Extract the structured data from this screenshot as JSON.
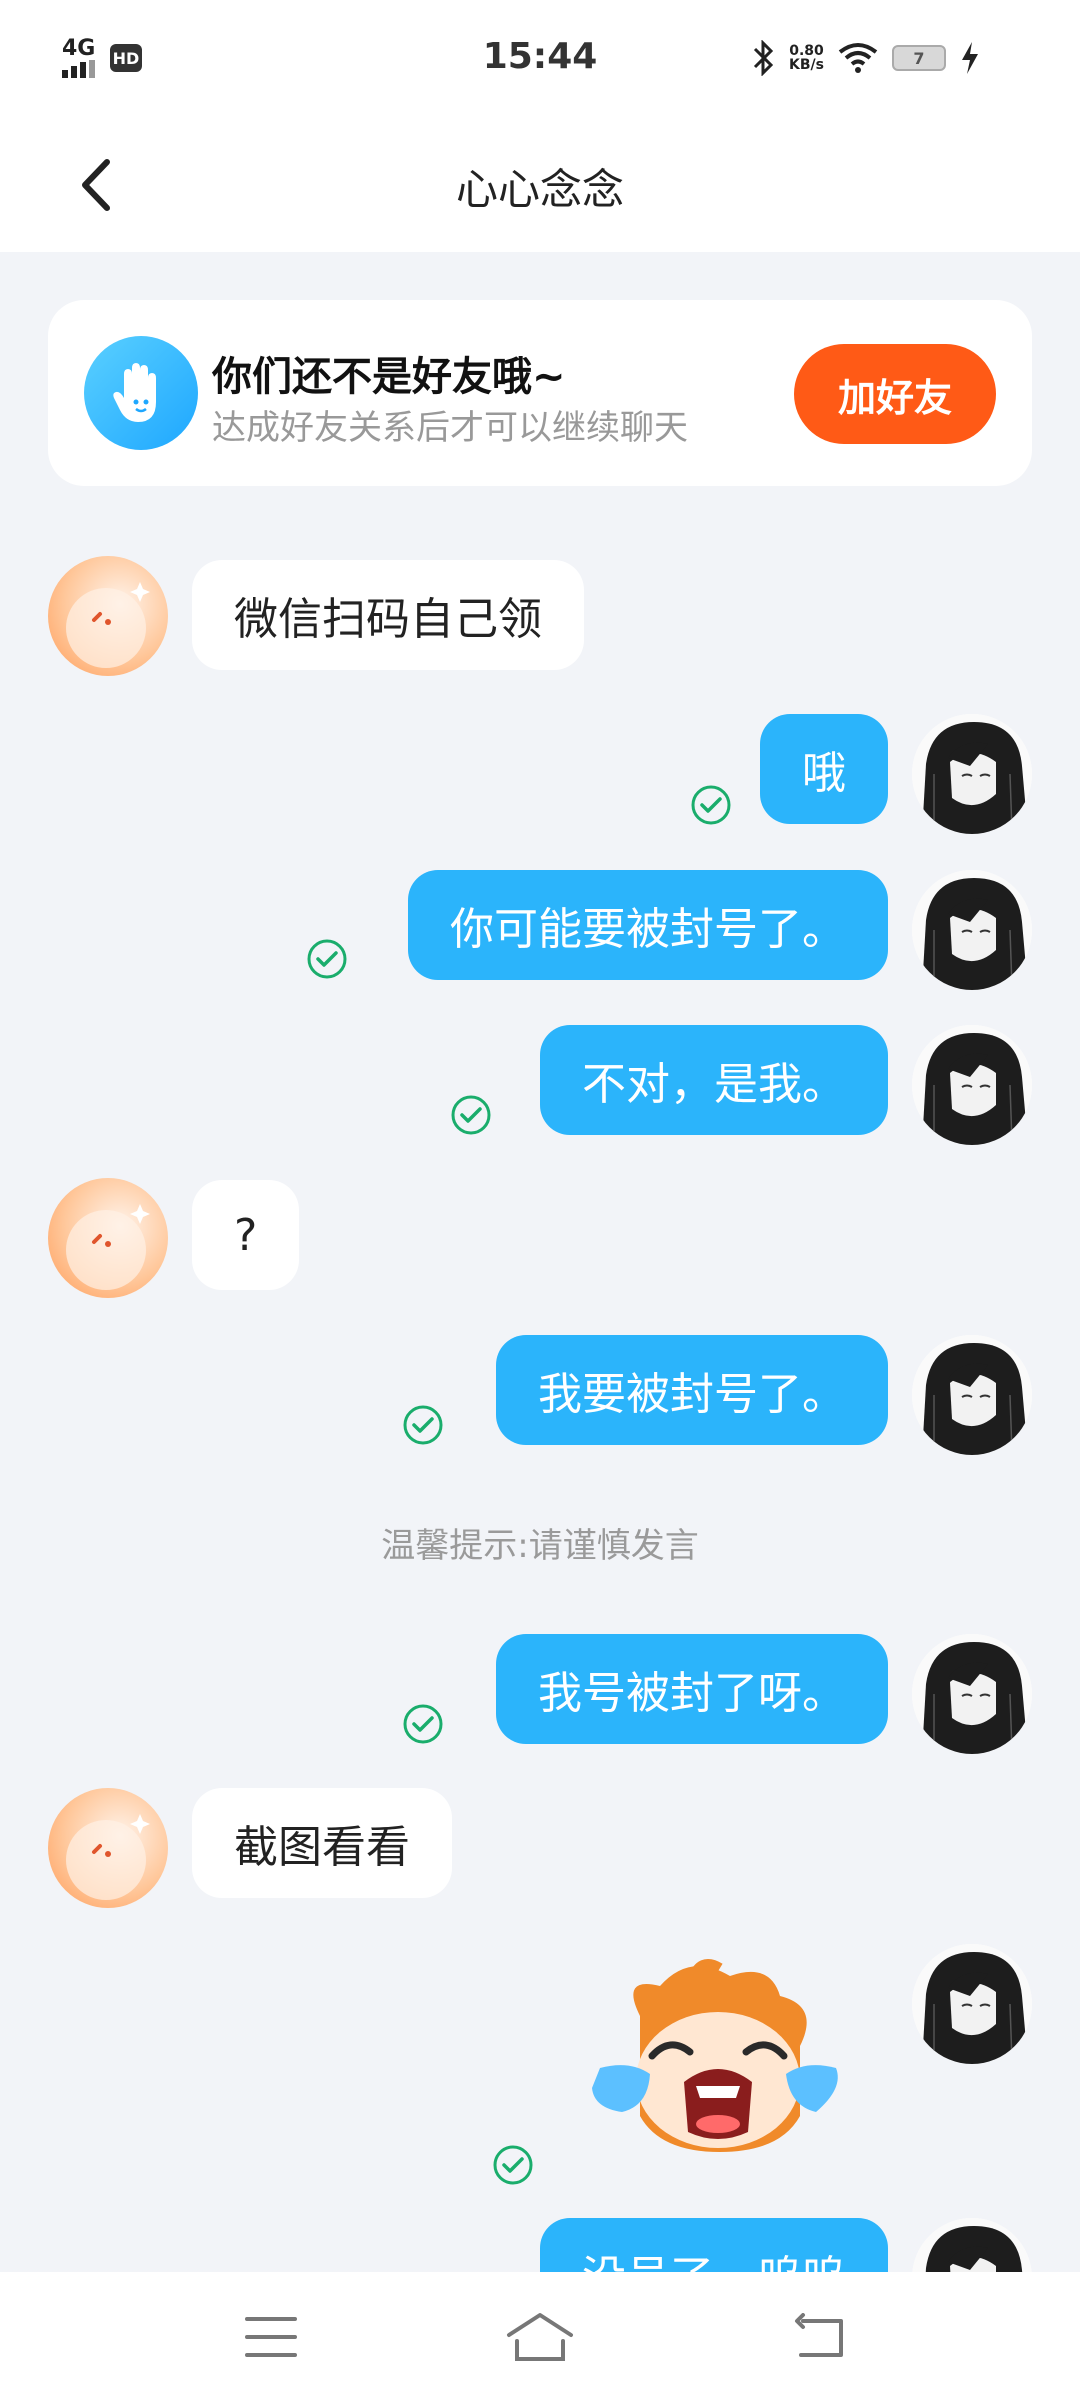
{
  "status_bar": {
    "network": "4G",
    "hd": "HD",
    "time": "15:44",
    "speed_value": "0.80",
    "speed_unit": "KB/s",
    "battery": "7"
  },
  "header": {
    "title": "心心念念"
  },
  "friend_banner": {
    "title": "你们还不是好友哦~",
    "subtitle": "达成好友关系后才可以继续聊天",
    "button": "加好友"
  },
  "messages": [
    {
      "side": "in",
      "text": "微信扫码自己领"
    },
    {
      "side": "out",
      "text": "哦"
    },
    {
      "side": "out",
      "text": "你可能要被封号了。"
    },
    {
      "side": "out",
      "text": "不对，是我。"
    },
    {
      "side": "in",
      "text": "?"
    },
    {
      "side": "out",
      "text": "我要被封号了。"
    },
    {
      "side": "out",
      "text": "我号被封了呀。"
    },
    {
      "side": "in",
      "text": "截图看看"
    },
    {
      "side": "out",
      "type": "sticker",
      "text": ""
    },
    {
      "side": "out",
      "text": "没号了，呜呜"
    }
  ],
  "tip": "温馨提示:请谨慎发言",
  "colors": {
    "accent_out": "#2bb4fb",
    "add_button": "#ff5a16",
    "check": "#1aad6c"
  }
}
